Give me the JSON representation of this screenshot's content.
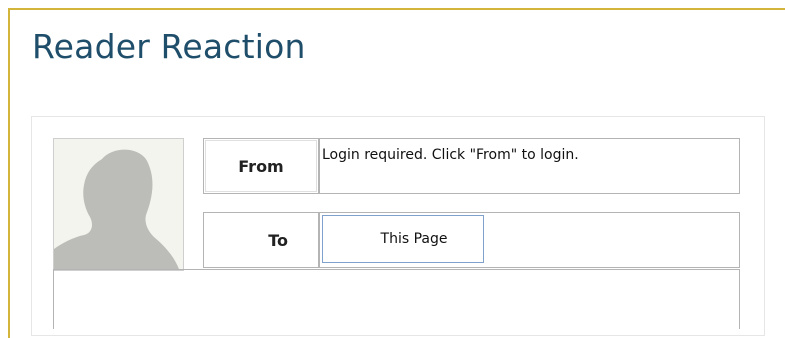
{
  "widget": {
    "title": "Reader Reaction"
  },
  "form": {
    "from_label": "From",
    "from_value": "Login required. Click \"From\" to login.",
    "to_label": "To",
    "to_value": "This Page"
  },
  "avatar": {
    "icon": "default-user-silhouette-icon"
  },
  "colors": {
    "frame_border": "#d4b53c",
    "title": "#1f4e6b",
    "to_field_border": "#7fa1cc"
  }
}
